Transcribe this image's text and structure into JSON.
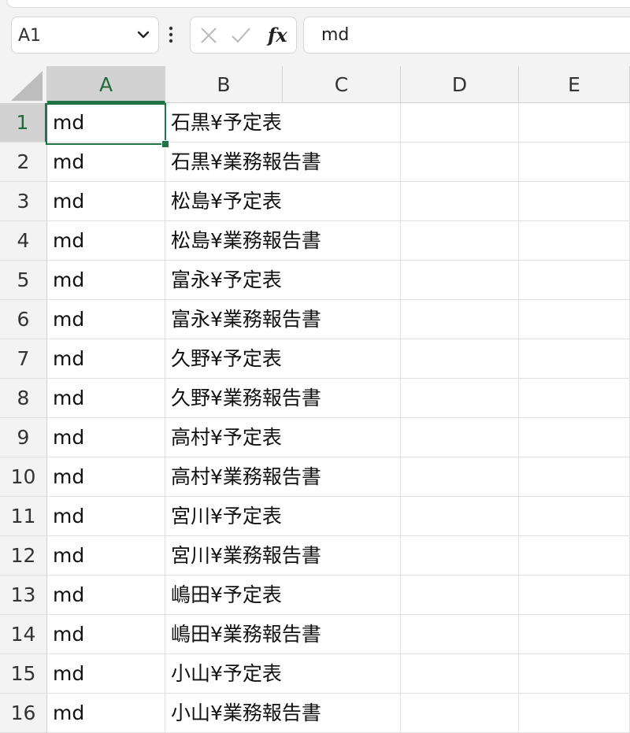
{
  "formula_bar": {
    "name_box": "A1",
    "formula": "md",
    "insert_function_label": "fx"
  },
  "columns": [
    "A",
    "B",
    "C",
    "D",
    "E"
  ],
  "rows": [
    {
      "num": "1",
      "a": "md",
      "b": "石黒¥予定表"
    },
    {
      "num": "2",
      "a": "md",
      "b": "石黒¥業務報告書"
    },
    {
      "num": "3",
      "a": "md",
      "b": "松島¥予定表"
    },
    {
      "num": "4",
      "a": "md",
      "b": "松島¥業務報告書"
    },
    {
      "num": "5",
      "a": "md",
      "b": "富永¥予定表"
    },
    {
      "num": "6",
      "a": "md",
      "b": "富永¥業務報告書"
    },
    {
      "num": "7",
      "a": "md",
      "b": "久野¥予定表"
    },
    {
      "num": "8",
      "a": "md",
      "b": "久野¥業務報告書"
    },
    {
      "num": "9",
      "a": "md",
      "b": "高村¥予定表"
    },
    {
      "num": "10",
      "a": "md",
      "b": "高村¥業務報告書"
    },
    {
      "num": "11",
      "a": "md",
      "b": "宮川¥予定表"
    },
    {
      "num": "12",
      "a": "md",
      "b": "宮川¥業務報告書"
    },
    {
      "num": "13",
      "a": "md",
      "b": "嶋田¥予定表"
    },
    {
      "num": "14",
      "a": "md",
      "b": "嶋田¥業務報告書"
    },
    {
      "num": "15",
      "a": "md",
      "b": "小山¥予定表"
    },
    {
      "num": "16",
      "a": "md",
      "b": "小山¥業務報告書"
    }
  ],
  "colors": {
    "accent": "#217346",
    "header_bg": "#f3f3f3",
    "selected_header_bg": "#d2d2d2"
  },
  "icons": {
    "dropdown": "chevron-down-icon",
    "more": "more-vertical-icon",
    "cancel": "close-icon",
    "enter": "check-icon"
  }
}
